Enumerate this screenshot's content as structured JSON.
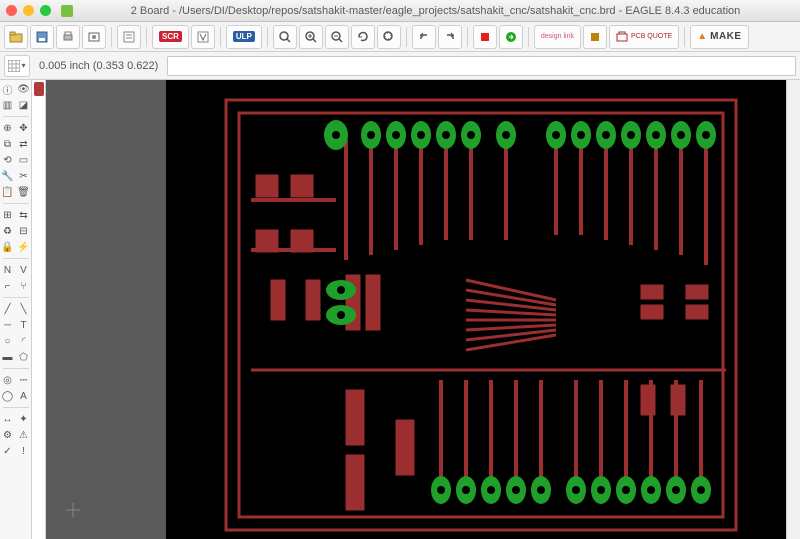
{
  "window": {
    "title": "2 Board - /Users/DI/Desktop/repos/satshakit-master/eagle_projects/satshakit_cnc/satshakit_cnc.brd - EAGLE 8.4.3 education"
  },
  "toolbar": {
    "scr_label": "SCR",
    "ulp_label": "ULP",
    "design_label": "design link",
    "pcb_label": "PCB QUOTE",
    "make_label": "MAKE",
    "make_prefix": "▲"
  },
  "status": {
    "coordinates": "0.005 inch (0.353 0.622)"
  },
  "layers": {
    "items": [
      {
        "color": "#b13b3b"
      },
      {
        "color": "#3b6fb1"
      }
    ]
  },
  "commandline": {
    "value": ""
  },
  "pcb": {
    "trace_color": "#9b2f2f",
    "pad_color": "#1fa02a",
    "pad_hole": "#000000"
  }
}
